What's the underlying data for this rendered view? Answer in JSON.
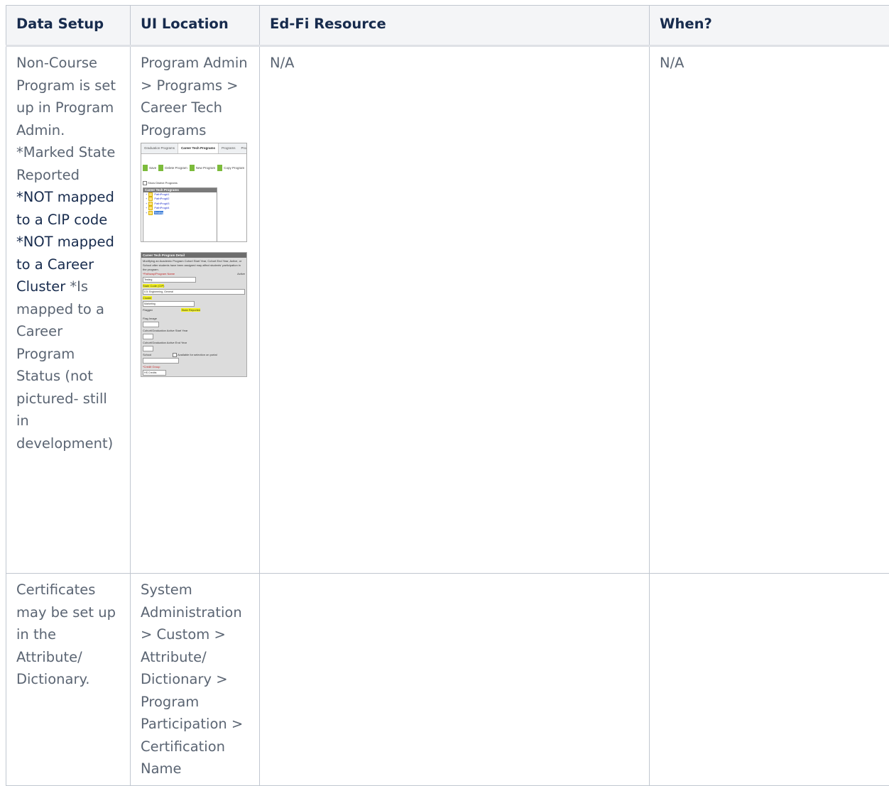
{
  "table": {
    "headers": [
      "Data Setup",
      "UI Location",
      "Ed-Fi Resource",
      "When?"
    ],
    "rows": [
      {
        "data_setup": {
          "part1": "Non-Course Program is set up in Program Admin. *Marked State Reported",
          "part2": "*NOT mapped to a CIP code *NOT mapped to a Career Cluster",
          "part3": "*Is mapped to a Career Program Status (not pictured- still in development)"
        },
        "ui_location": "Program Admin > Programs > Career Tech Programs",
        "edfi_resource": "N/A",
        "when": "N/A"
      },
      {
        "data_setup": "Certificates may be set up in the Attribute/ Dictionary.",
        "ui_location": "System Administration > Custom > Attribute/ Dictionary > Program Participation > Certification Name",
        "edfi_resource": "",
        "when": ""
      }
    ]
  },
  "screenshot1": {
    "tabs": [
      "Graduation Programs",
      "Career Tech Programs",
      "Programs",
      "Program Sessions"
    ],
    "active_tab": "Career Tech Programs",
    "buttons": [
      "Save",
      "Delete Program",
      "New Program",
      "Copy Program"
    ],
    "checkbox_label": "Show District Programs",
    "tree_header": "Career Tech Programs",
    "tree_items": [
      "PathProg#1",
      "PathProg#2",
      "PathProg#3",
      "PathProg#4",
      "Testing"
    ]
  },
  "screenshot2": {
    "header": "Career Tech Program Detail",
    "notice": "Modifying an Academic Program Cohort Start Year, Cohort End Year, Active, or School after students have been assigned may affect students' participation in the program.",
    "name_label": "*Pathway/Program Name",
    "name_value": "Testing",
    "active_label": "Active",
    "state_code_label": "State Code (CIP)",
    "state_code_value": "0.5: Engineering, General",
    "cluster_label": "Cluster",
    "cluster_value": "Marketing",
    "flagged_label": "Flagged",
    "state_reported_label": "State Reported",
    "flag_image_label": "Flag Image",
    "start_year_label": "Cohort/Graduation Active Start Year",
    "end_year_label": "Cohort/Graduation Active End Year",
    "school_label": "School",
    "portal_label": "Available for selection on portal",
    "credit_group_label": "*Credit Group",
    "credit_group_value": "HS Credits"
  }
}
